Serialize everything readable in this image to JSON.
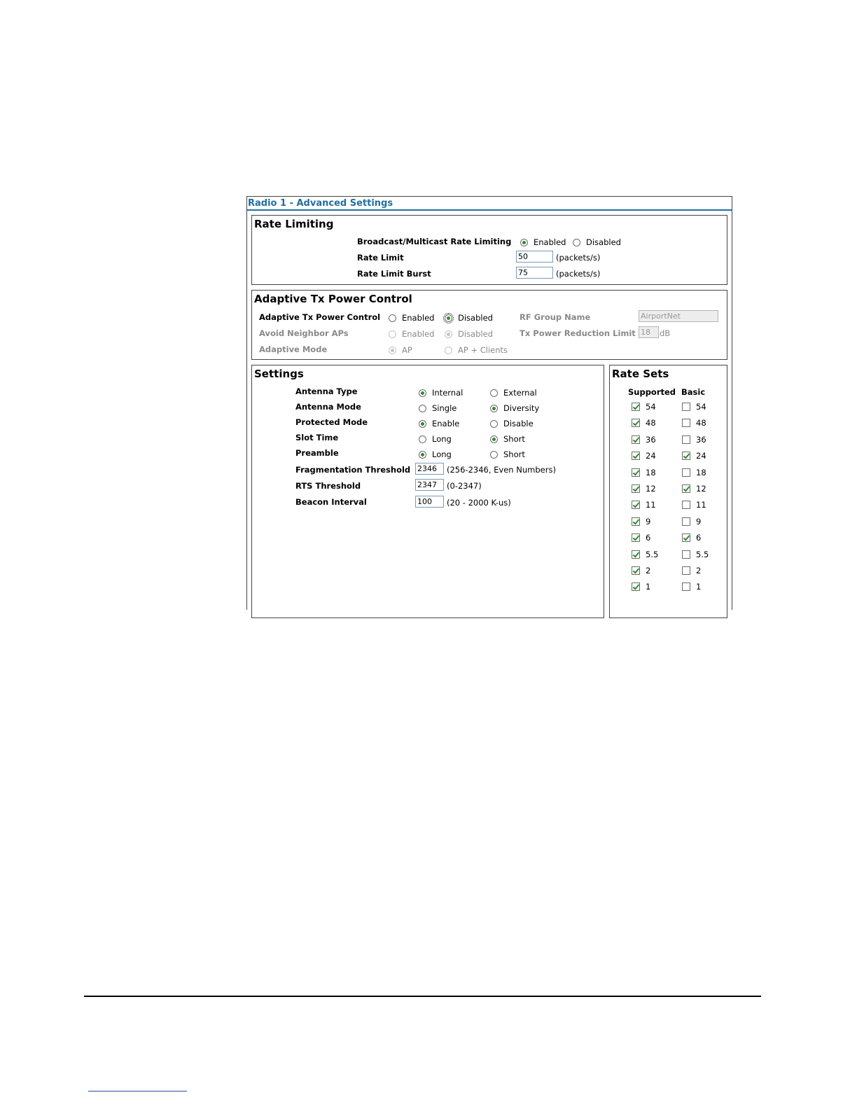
{
  "panel": {
    "title": "Radio 1 - Advanced Settings"
  },
  "rate_limiting": {
    "title": "Rate Limiting",
    "broadcast_label": "Broadcast/Multicast Rate Limiting",
    "enabled_label": "Enabled",
    "disabled_label": "Disabled",
    "rate_limit_label": "Rate Limit",
    "rate_limit_value": "50",
    "rate_limit_unit": "(packets/s)",
    "rate_limit_burst_label": "Rate Limit Burst",
    "rate_limit_burst_value": "75",
    "rate_limit_burst_unit": "(packets/s)"
  },
  "adaptive": {
    "title": "Adaptive Tx Power Control",
    "control_label": "Adaptive Tx Power Control",
    "control_enabled": "Enabled",
    "control_disabled": "Disabled",
    "avoid_label": "Avoid Neighbor APs",
    "avoid_enabled": "Enabled",
    "avoid_disabled": "Disabled",
    "mode_label": "Adaptive Mode",
    "mode_ap": "AP",
    "mode_ap_clients": "AP + Clients",
    "rf_group_label": "RF Group Name",
    "rf_group_value": "AirportNet",
    "reduction_label": "Tx Power Reduction Limit",
    "reduction_value": "18",
    "reduction_unit": "dB"
  },
  "settings": {
    "title": "Settings",
    "antenna_type_label": "Antenna Type",
    "antenna_type_internal": "Internal",
    "antenna_type_external": "External",
    "antenna_mode_label": "Antenna Mode",
    "antenna_mode_single": "Single",
    "antenna_mode_diversity": "Diversity",
    "protected_mode_label": "Protected Mode",
    "protected_enable": "Enable",
    "protected_disable": "Disable",
    "slot_time_label": "Slot Time",
    "slot_long": "Long",
    "slot_short": "Short",
    "preamble_label": "Preamble",
    "preamble_long": "Long",
    "preamble_short": "Short",
    "frag_label": "Fragmentation Threshold",
    "frag_value": "2346",
    "frag_hint": "(256-2346, Even Numbers)",
    "rts_label": "RTS Threshold",
    "rts_value": "2347",
    "rts_hint": "(0-2347)",
    "beacon_label": "Beacon Interval",
    "beacon_value": "100",
    "beacon_hint": "(20 - 2000 K-us)"
  },
  "rate_sets": {
    "title": "Rate Sets",
    "supported_header": "Supported",
    "basic_header": "Basic",
    "rows": [
      {
        "rate": "54",
        "supported": true,
        "basic": false
      },
      {
        "rate": "48",
        "supported": true,
        "basic": false
      },
      {
        "rate": "36",
        "supported": true,
        "basic": false
      },
      {
        "rate": "24",
        "supported": true,
        "basic": true
      },
      {
        "rate": "18",
        "supported": true,
        "basic": false
      },
      {
        "rate": "12",
        "supported": true,
        "basic": true
      },
      {
        "rate": "11",
        "supported": true,
        "basic": false
      },
      {
        "rate": "9",
        "supported": true,
        "basic": false
      },
      {
        "rate": "6",
        "supported": true,
        "basic": true
      },
      {
        "rate": "5.5",
        "supported": true,
        "basic": false
      },
      {
        "rate": "2",
        "supported": true,
        "basic": false
      },
      {
        "rate": "1",
        "supported": true,
        "basic": false
      }
    ]
  }
}
